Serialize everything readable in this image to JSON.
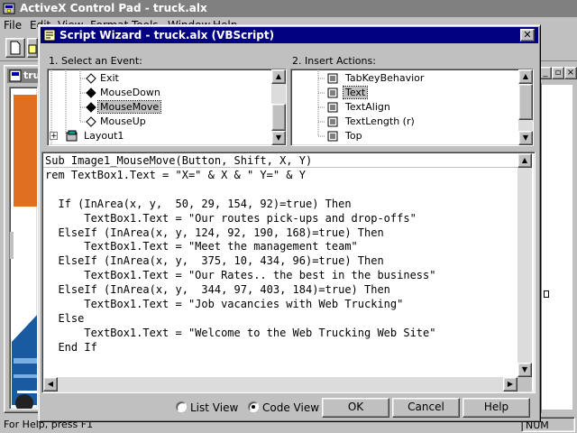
{
  "app": {
    "title": "ActiveX Control Pad - truck.alx",
    "menu": [
      "File",
      "Edit",
      "View",
      "Format",
      "Tools",
      "Window",
      "Help"
    ],
    "status_text": "For Help, press F1",
    "status_num": "NUM",
    "child_title": "tru"
  },
  "dialog": {
    "title": "Script Wizard - truck.alx (VBScript)",
    "event_label": "1. Select an Event:",
    "action_label": "2. Insert Actions:",
    "events": [
      {
        "label": "Exit",
        "icon": "diamond-outline-icon"
      },
      {
        "label": "MouseDown",
        "icon": "diamond-filled-icon"
      },
      {
        "label": "MouseMove",
        "icon": "diamond-filled-icon",
        "selected": true
      },
      {
        "label": "MouseUp",
        "icon": "diamond-outline-icon"
      },
      {
        "label": "Layout1",
        "icon": "layout-object-icon",
        "expander": "+"
      }
    ],
    "actions": [
      {
        "label": "TabKeyBehavior",
        "icon": "property-icon"
      },
      {
        "label": "Text",
        "icon": "property-icon",
        "selected": true
      },
      {
        "label": "TextAlign",
        "icon": "property-icon"
      },
      {
        "label": "TextLength (r)",
        "icon": "property-icon"
      },
      {
        "label": "Top",
        "icon": "property-icon"
      }
    ],
    "code_lines": [
      "Sub Image1_MouseMove(Button, Shift, X, Y)",
      "rem TextBox1.Text = \"X=\" & X & \" Y=\" & Y",
      "",
      "  If (InArea(x, y,  50, 29, 154, 92)=true) Then",
      "      TextBox1.Text = \"Our routes pick-ups and drop-offs\"",
      "  ElseIf (InArea(x, y, 124, 92, 190, 168)=true) Then",
      "      TextBox1.Text = \"Meet the management team\"",
      "  ElseIf (InArea(x, y,  375, 10, 434, 96)=true) Then",
      "      TextBox1.Text = \"Our Rates.. the best in the business\"",
      "  ElseIf (InArea(x, y,  344, 97, 403, 184)=true) Then",
      "      TextBox1.Text = \"Job vacancies with Web Trucking\"",
      "  Else",
      "      TextBox1.Text = \"Welcome to the Web Trucking Web Site\"",
      "  End If"
    ],
    "view_options": {
      "list": "List View",
      "code": "Code View",
      "selected": "code"
    },
    "buttons": {
      "ok": "OK",
      "cancel": "Cancel",
      "help": "Help"
    }
  },
  "colors": {
    "titlebar_active": "#000080",
    "titlebar_inactive": "#808080",
    "truck_orange": "#e07020",
    "truck_blue": "#1a5aa0",
    "selection_face": "#c0c0c0"
  }
}
